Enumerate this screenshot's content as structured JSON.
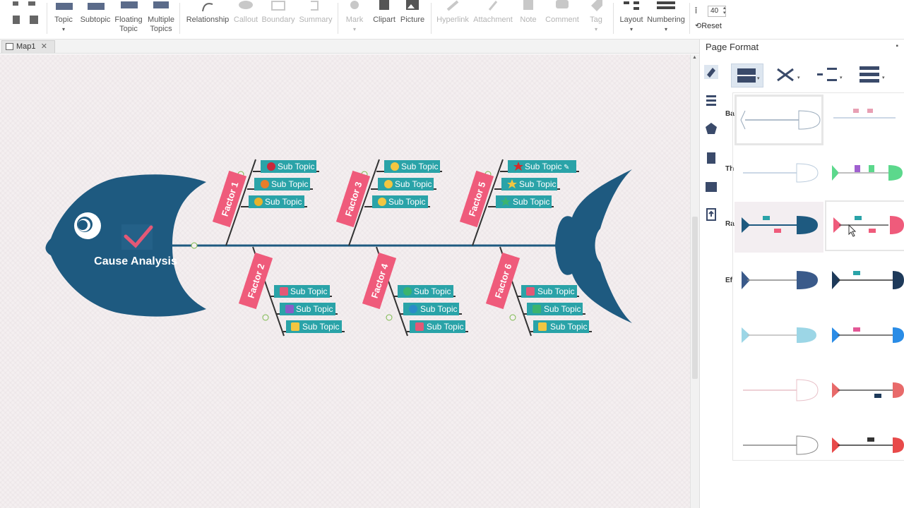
{
  "toolbar": {
    "topic": "Topic",
    "subtopic": "Subtopic",
    "floating_topic": "Floating Topic",
    "multiple_topics": "Multiple Topics",
    "relationship": "Relationship",
    "callout": "Callout",
    "boundary": "Boundary",
    "summary": "Summary",
    "mark": "Mark",
    "clipart": "Clipart",
    "picture": "Picture",
    "hyperlink": "Hyperlink",
    "attachment": "Attachment",
    "note": "Note",
    "comment": "Comment",
    "tag": "Tag",
    "layout": "Layout",
    "numbering": "Numbering",
    "spacing_value": "40",
    "reset": "Reset"
  },
  "tab": {
    "name": "Map1",
    "close": "✕"
  },
  "diagram": {
    "central_topic": "Cause Analysis",
    "factors": [
      "Factor 1",
      "Factor 2",
      "Factor 3",
      "Factor 4",
      "Factor 5",
      "Factor 6"
    ],
    "sub_topic": "Sub Topic",
    "colors": {
      "fish": "#1e5a80",
      "factor": "#ef5b7b",
      "subtopic": "#2aa3a8",
      "spine": "#1e5a80",
      "check": "#e35876"
    }
  },
  "panel": {
    "title": "Page Format",
    "groups": [
      "Ba",
      "Th",
      "Ra",
      "Ef"
    ]
  }
}
